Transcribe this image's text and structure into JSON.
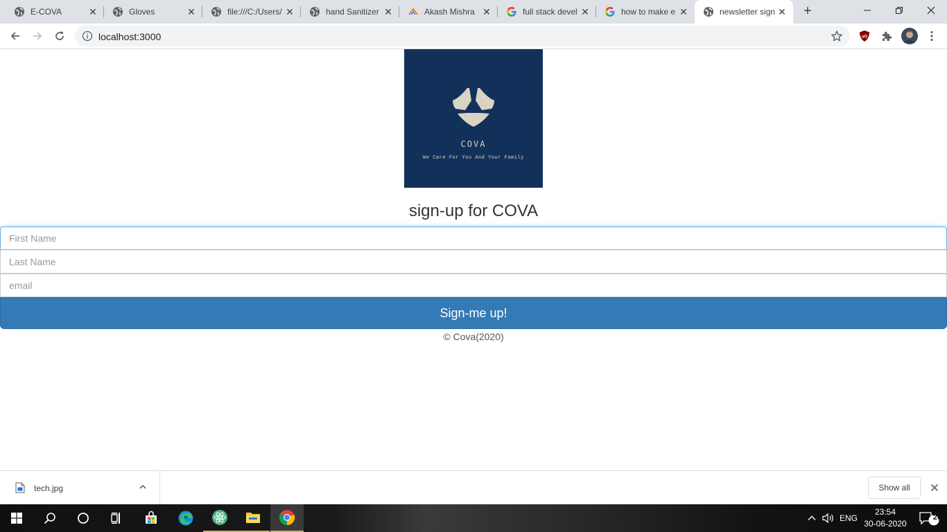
{
  "browser": {
    "tabs": [
      {
        "title": "E-COVA",
        "icon": "globe-icon",
        "active": false
      },
      {
        "title": "Gloves",
        "icon": "globe-icon",
        "active": false
      },
      {
        "title": "file:///C:/Users/",
        "icon": "globe-icon",
        "active": false
      },
      {
        "title": "hand Sanitizer",
        "icon": "globe-icon",
        "active": false
      },
      {
        "title": "Akash Mishra",
        "icon": "akash-logo-icon",
        "active": false
      },
      {
        "title": "full stack devel",
        "icon": "google-icon",
        "active": false
      },
      {
        "title": "how to make e",
        "icon": "google-icon",
        "active": false
      },
      {
        "title": "newsletter sign",
        "icon": "globe-icon",
        "active": true
      }
    ],
    "url": "localhost:3000"
  },
  "page": {
    "logo": {
      "brand": "COVA",
      "tagline": "We Care For You And Your Family",
      "background": "#12315a",
      "foreground": "#d9d3c3"
    },
    "heading": "sign-up for COVA",
    "fields": {
      "first_name_placeholder": "First Name",
      "last_name_placeholder": "Last Name",
      "email_placeholder": "email"
    },
    "submit_label": "Sign-me up!",
    "footer": "© Cova(2020)",
    "accent": "#337ab7"
  },
  "downloads": {
    "file_name": "tech.jpg",
    "show_all_label": "Show all"
  },
  "taskbar": {
    "apps": [
      "start-icon",
      "search-icon",
      "cortana-icon",
      "task-view-icon",
      "store-icon",
      "edge-icon",
      "atom-icon",
      "file-explorer-icon",
      "chrome-icon"
    ],
    "language": "ENG",
    "time": "23:54",
    "date": "30-06-2020",
    "notification_count": "26"
  }
}
